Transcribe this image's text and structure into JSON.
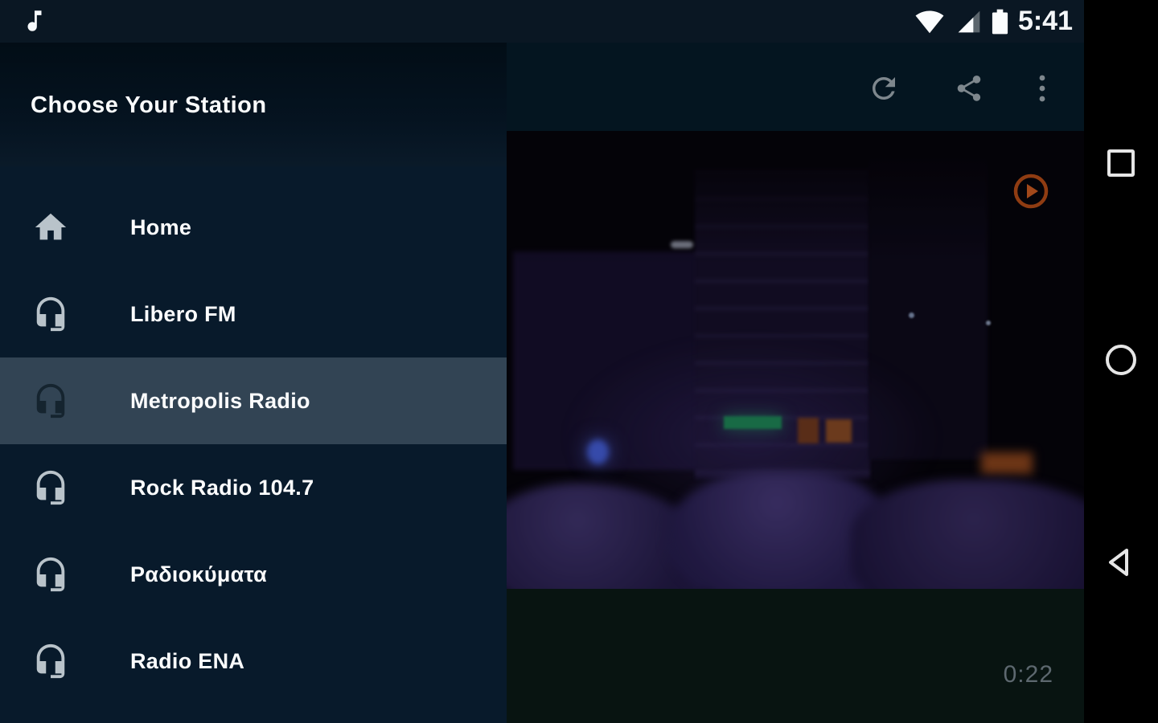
{
  "status_bar": {
    "time": "5:41",
    "icons": [
      "music-note-icon",
      "wifi-icon",
      "cellular-signal-icon",
      "battery-icon"
    ]
  },
  "drawer": {
    "title": "Choose Your Station",
    "items": [
      {
        "label": "Home",
        "icon": "house-icon",
        "selected": false
      },
      {
        "label": "Libero FM",
        "icon": "headset-icon",
        "selected": false
      },
      {
        "label": "Metropolis Radio",
        "icon": "headset-icon",
        "selected": true
      },
      {
        "label": "Rock Radio 104.7",
        "icon": "headset-icon",
        "selected": false
      },
      {
        "label": "Ραδιοκύματα",
        "icon": "headset-icon",
        "selected": false
      },
      {
        "label": "Radio ENA",
        "icon": "headset-icon",
        "selected": false
      }
    ]
  },
  "player": {
    "toolbar_icons": [
      "refresh-icon",
      "share-icon",
      "overflow-menu-icon"
    ],
    "play_button_icon": "play-icon",
    "elapsed_time": "0:22"
  },
  "nav_bar": {
    "buttons": [
      "recents-square-icon",
      "home-circle-icon",
      "back-triangle-icon"
    ]
  },
  "colors": {
    "status_bar_bg": "#0a1723",
    "drawer_list_bg": "#081a2b",
    "drawer_header_bg": "#051320",
    "selected_item_bg": "#324454",
    "item_icon_gray": "#b9c3ca",
    "toolbar_icon_gray": "#7e878d",
    "play_accent_orange": "#9c4418",
    "nav_bar_bg": "#000000",
    "elapsed_text": "#5d686f"
  }
}
